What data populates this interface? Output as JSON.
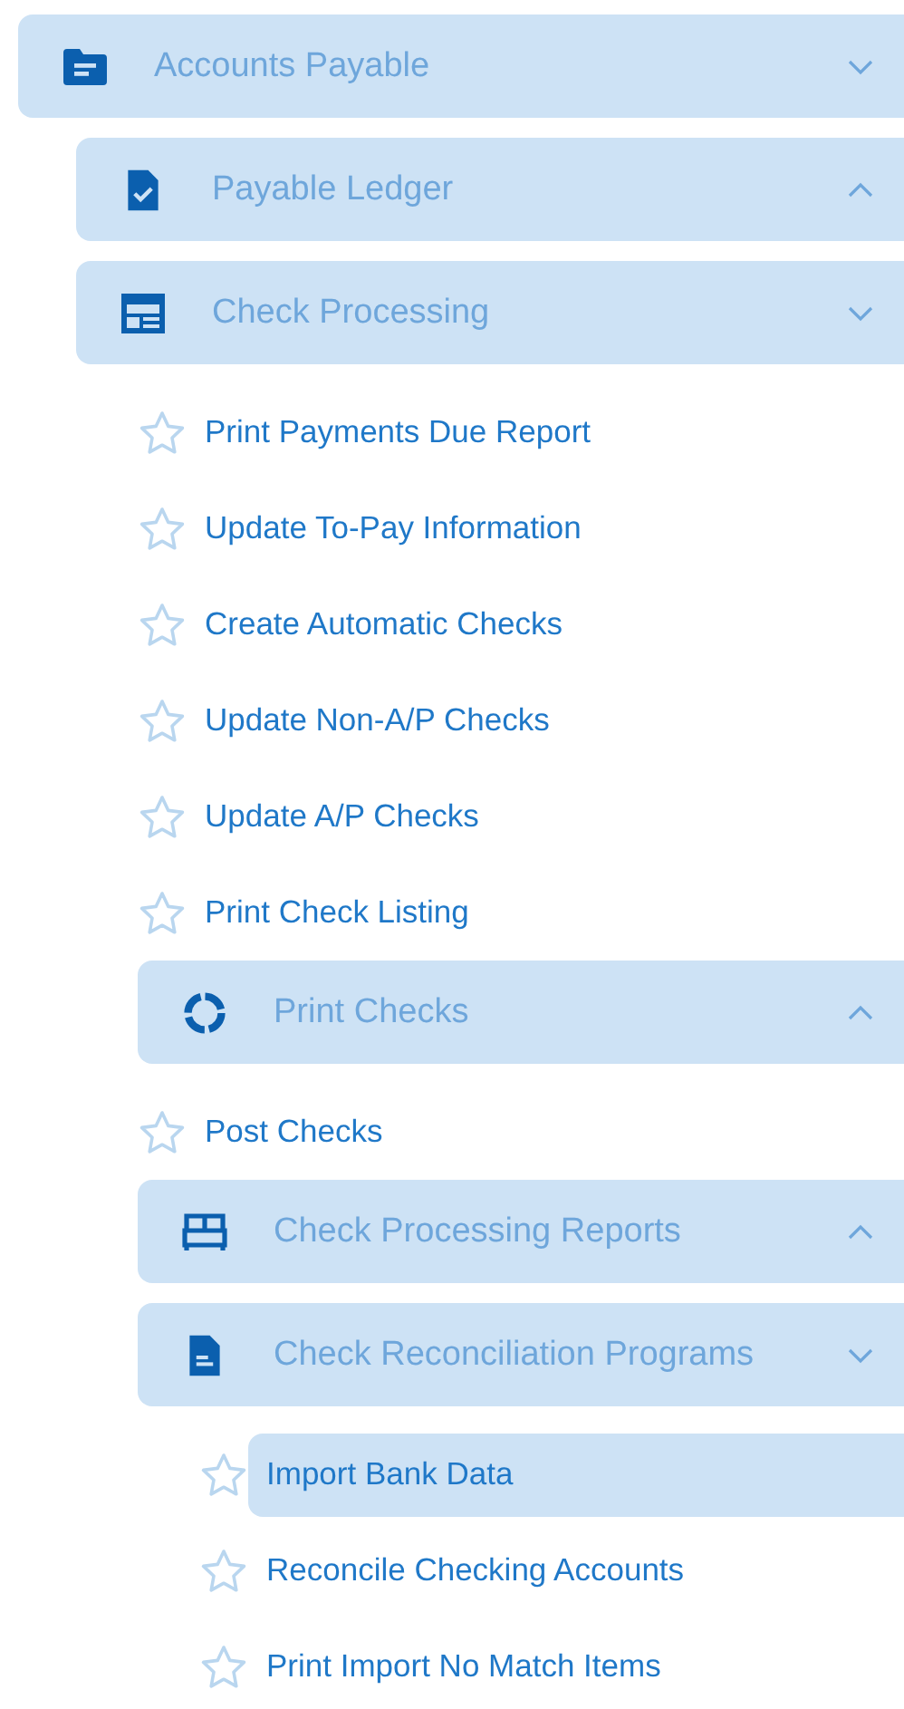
{
  "menu": [
    {
      "kind": "group",
      "label": "Accounts Payable",
      "expanded": true,
      "children": [
        {
          "kind": "group",
          "label": "Payable Ledger",
          "expanded": false
        },
        {
          "kind": "group",
          "label": "Check Processing",
          "expanded": true,
          "children": [
            {
              "kind": "item",
              "label": "Print Payments Due Report",
              "selected": false
            },
            {
              "kind": "item",
              "label": "Update To-Pay Information",
              "selected": false
            },
            {
              "kind": "item",
              "label": "Create Automatic Checks",
              "selected": false
            },
            {
              "kind": "item",
              "label": "Update Non-A/P Checks",
              "selected": false
            },
            {
              "kind": "item",
              "label": "Update A/P Checks",
              "selected": false
            },
            {
              "kind": "item",
              "label": "Print Check Listing",
              "selected": false
            },
            {
              "kind": "group",
              "label": "Print Checks",
              "expanded": false
            },
            {
              "kind": "item",
              "label": "Post Checks",
              "selected": false
            },
            {
              "kind": "group",
              "label": "Check Processing Reports",
              "expanded": false
            },
            {
              "kind": "group",
              "label": "Check Reconciliation Programs",
              "expanded": true,
              "children": [
                {
                  "kind": "item",
                  "label": "Import Bank Data",
                  "selected": true
                },
                {
                  "kind": "item",
                  "label": "Reconcile Checking Accounts",
                  "selected": false
                },
                {
                  "kind": "item",
                  "label": "Print Import No Match Items",
                  "selected": false
                }
              ]
            }
          ]
        }
      ]
    }
  ]
}
